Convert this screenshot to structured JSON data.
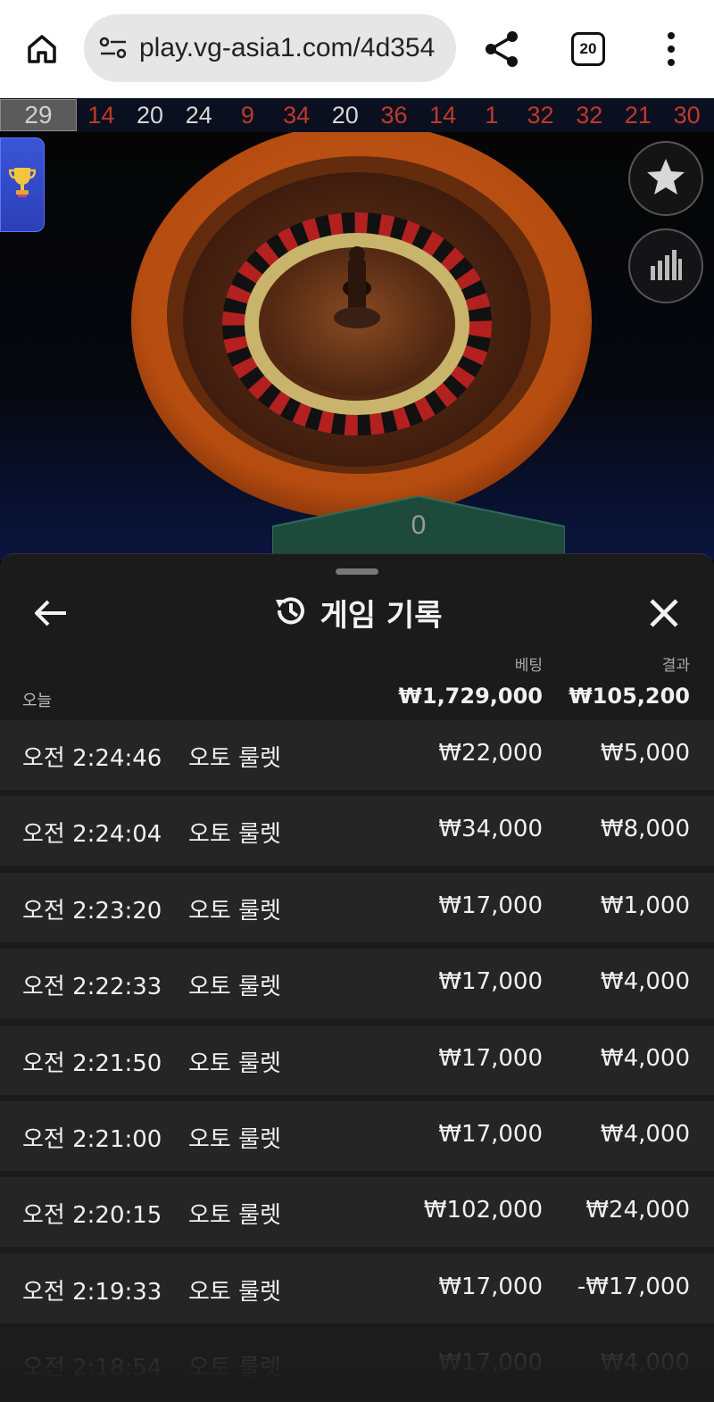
{
  "browser": {
    "url": "play.vg-asia1.com/4d354",
    "tab_count": "20",
    "icons": [
      "home-icon",
      "site-settings-icon",
      "share-icon",
      "tabs-icon",
      "more-vert-icon"
    ]
  },
  "roulette_history": {
    "current": "29",
    "numbers": [
      {
        "n": "14",
        "color": "red"
      },
      {
        "n": "20",
        "color": "black"
      },
      {
        "n": "24",
        "color": "black"
      },
      {
        "n": "9",
        "color": "red"
      },
      {
        "n": "34",
        "color": "red"
      },
      {
        "n": "20",
        "color": "black"
      },
      {
        "n": "36",
        "color": "red"
      },
      {
        "n": "14",
        "color": "red"
      },
      {
        "n": "1",
        "color": "red"
      },
      {
        "n": "32",
        "color": "red"
      },
      {
        "n": "32",
        "color": "red"
      },
      {
        "n": "21",
        "color": "red"
      },
      {
        "n": "30",
        "color": "red"
      }
    ]
  },
  "video": {
    "score": "0",
    "icons": [
      "trophy-icon",
      "star-icon",
      "statistics-icon"
    ]
  },
  "sheet": {
    "title": "게임 기록",
    "icons": [
      "back-arrow-icon",
      "history-icon",
      "close-icon"
    ],
    "columns": {
      "bet": "베팅",
      "result": "결과"
    },
    "summary": {
      "label": "오늘",
      "bet_total": "₩1,729,000",
      "result_total": "₩105,200"
    },
    "rows": [
      {
        "time": "오전 2:24:46",
        "game": "오토 룰렛",
        "bet": "₩22,000",
        "result": "₩5,000"
      },
      {
        "time": "오전 2:24:04",
        "game": "오토 룰렛",
        "bet": "₩34,000",
        "result": "₩8,000"
      },
      {
        "time": "오전 2:23:20",
        "game": "오토 룰렛",
        "bet": "₩17,000",
        "result": "₩1,000"
      },
      {
        "time": "오전 2:22:33",
        "game": "오토 룰렛",
        "bet": "₩17,000",
        "result": "₩4,000"
      },
      {
        "time": "오전 2:21:50",
        "game": "오토 룰렛",
        "bet": "₩17,000",
        "result": "₩4,000"
      },
      {
        "time": "오전 2:21:00",
        "game": "오토 룰렛",
        "bet": "₩17,000",
        "result": "₩4,000"
      },
      {
        "time": "오전 2:20:15",
        "game": "오토 룰렛",
        "bet": "₩102,000",
        "result": "₩24,000"
      },
      {
        "time": "오전 2:19:33",
        "game": "오토 룰렛",
        "bet": "₩17,000",
        "result": "-₩17,000"
      },
      {
        "time": "오전 2:18:54",
        "game": "오토 룰렛",
        "bet": "₩17,000",
        "result": "₩4,000"
      }
    ]
  }
}
